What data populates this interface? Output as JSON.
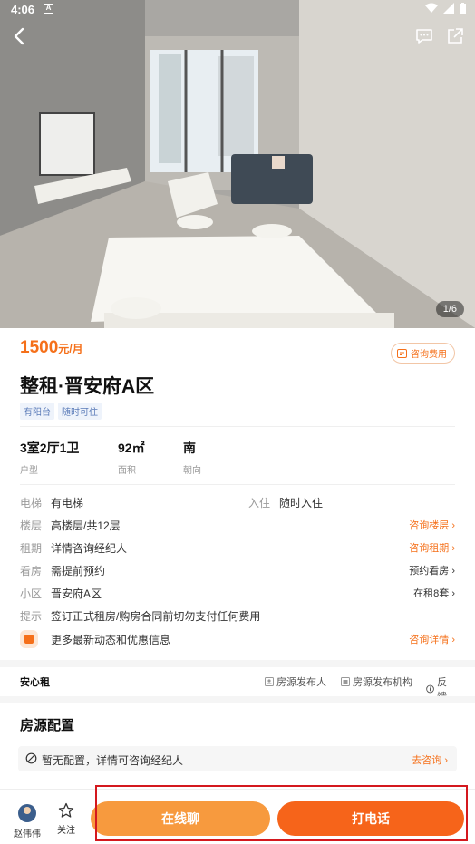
{
  "status_bar": {
    "time": "4:06",
    "sim_label": "A"
  },
  "gallery": {
    "counter": "1/6"
  },
  "listing": {
    "price": "1500",
    "price_unit": "元/月",
    "consult_fee_label": "咨询费用",
    "title": "整租·晋安府A区",
    "tags": [
      "有阳台",
      "随时可住"
    ]
  },
  "stats": [
    {
      "value": "3室2厅1卫",
      "key": "户型"
    },
    {
      "value": "92㎡",
      "key": "面积"
    },
    {
      "value": "南",
      "key": "朝向"
    }
  ],
  "info": {
    "elevator_label": "电梯",
    "elevator_value": "有电梯",
    "movein_label": "入住",
    "movein_value": "随时入住",
    "floor_label": "楼层",
    "floor_value": "高楼层/共12层",
    "floor_link": "咨询楼层",
    "term_label": "租期",
    "term_value": "详情咨询经纪人",
    "term_link": "咨询租期",
    "viewing_label": "看房",
    "viewing_value": "需提前预约",
    "viewing_link": "预约看房",
    "community_label": "小区",
    "community_value": "晋安府A区",
    "community_link": "在租8套",
    "tip_label": "提示",
    "tip_value": "签订正式租房/购房合同前切勿支付任何费用",
    "promo_value": "更多最新动态和优惠信息",
    "promo_link": "咨询详情"
  },
  "trust": {
    "brand": "安心租",
    "publisher": "房源发布人",
    "org": "房源发布机构",
    "feedback": "反馈"
  },
  "config": {
    "title": "房源配置",
    "empty_text": "暂无配置，详情可咨询经纪人",
    "link": "去咨询"
  },
  "bottom": {
    "agent_name": "赵伟伟",
    "follow_label": "关注",
    "chat_label": "在线聊",
    "call_label": "打电话"
  },
  "colors": {
    "accent": "#f5701a",
    "chat_button": "#f79a3e",
    "call_button": "#f6641a",
    "highlight_box": "#d4181e"
  }
}
